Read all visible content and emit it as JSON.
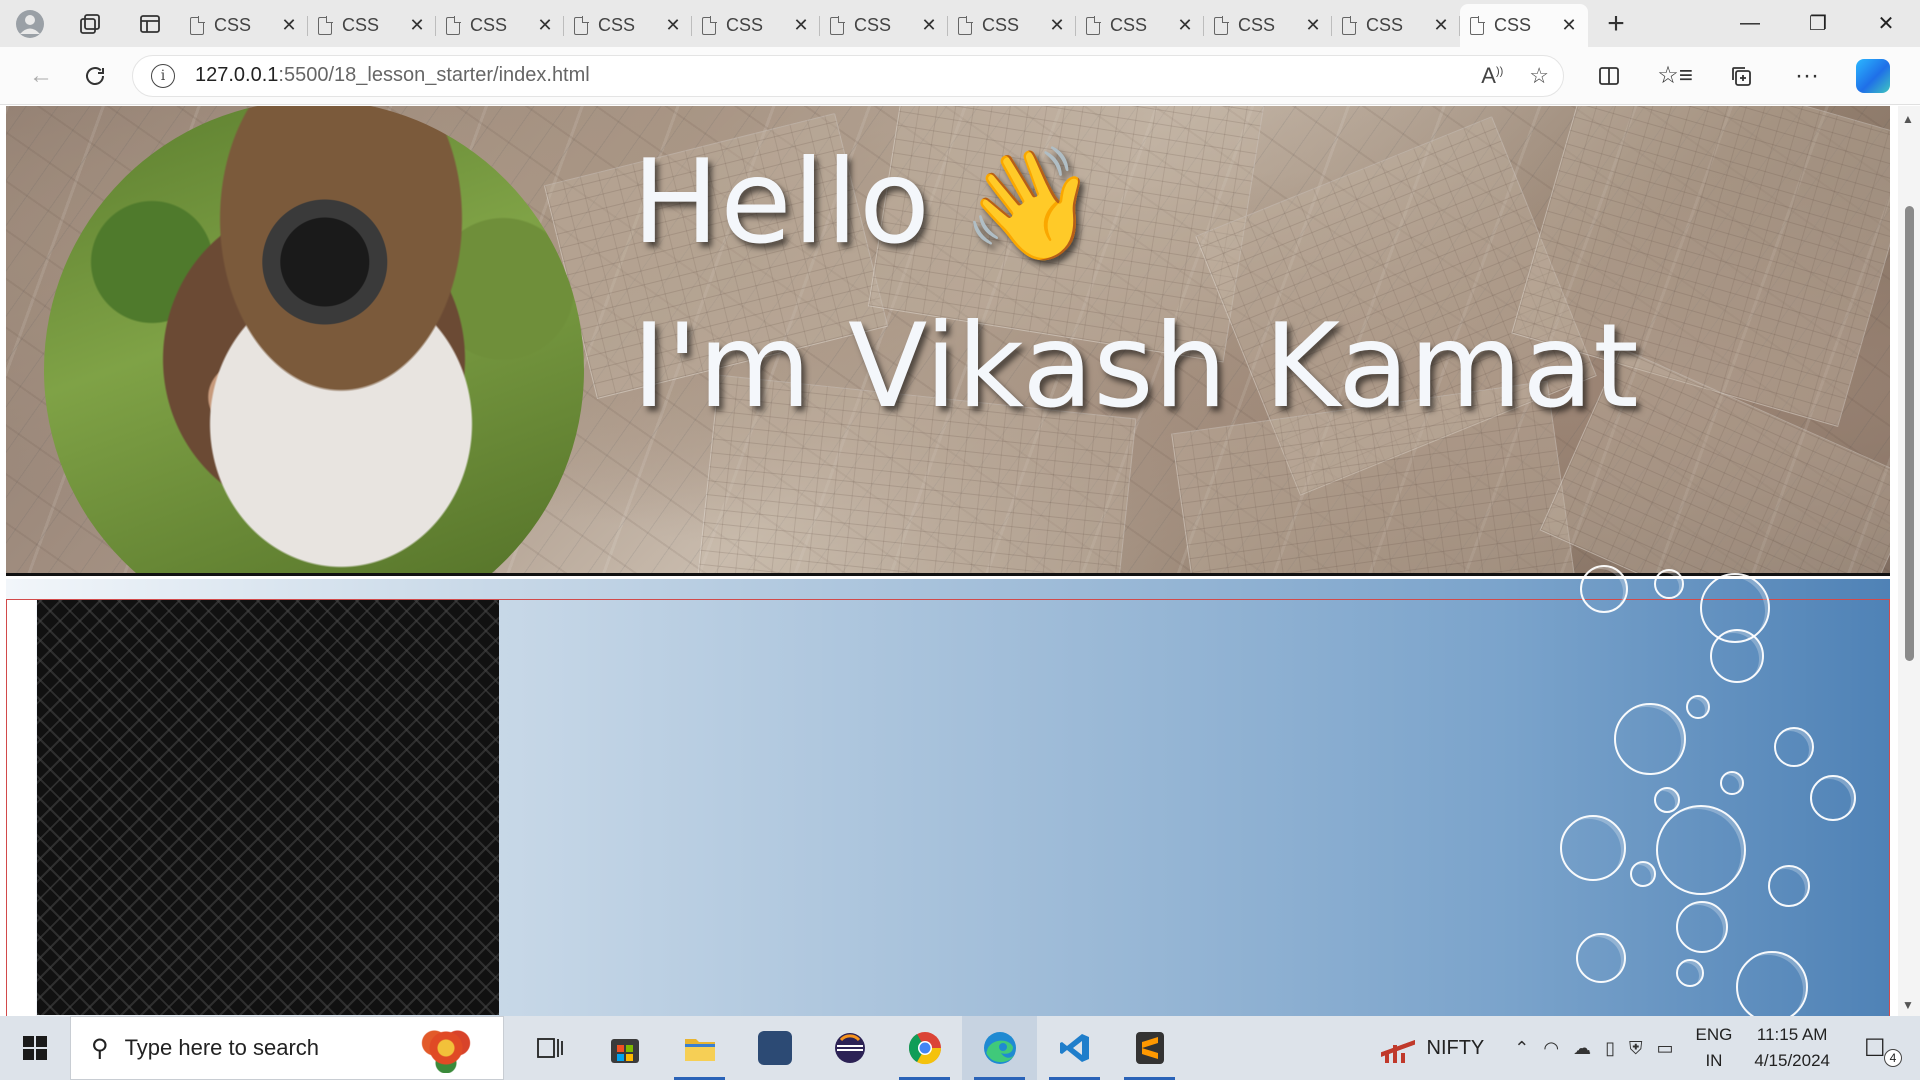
{
  "browser": {
    "tabs": [
      {
        "label": "CSS"
      },
      {
        "label": "CSS"
      },
      {
        "label": "CSS"
      },
      {
        "label": "CSS"
      },
      {
        "label": "CSS"
      },
      {
        "label": "CSS"
      },
      {
        "label": "CSS"
      },
      {
        "label": "CSS"
      },
      {
        "label": "CSS"
      },
      {
        "label": "CSS"
      },
      {
        "label": "CSS",
        "active": true
      }
    ],
    "close_glyph": "✕",
    "new_tab_glyph": "+",
    "url_host": "127.0.0.1",
    "url_rest": ":5500/18_lesson_starter/index.html",
    "info_glyph": "i"
  },
  "page": {
    "hello": "Hello",
    "wave_emoji": "👋",
    "name": "I'm Vikash Kamat"
  },
  "taskbar": {
    "search_placeholder": "Type here to search",
    "ticker_label": "NIFTY",
    "lang_line1": "ENG",
    "lang_line2": "IN",
    "time": "11:15 AM",
    "date": "4/15/2024",
    "notification_count": "4"
  },
  "icons": {
    "profile": "profile-icon",
    "workspaces": "workspaces-icon",
    "tab_actions": "vertical-tabs-icon",
    "back": "back-arrow-icon",
    "refresh": "refresh-icon",
    "read_aloud": "read-aloud-icon",
    "favorite": "star-icon",
    "split": "split-screen-icon",
    "favorites": "favorites-list-icon",
    "collections": "collections-icon",
    "more": "more-icon",
    "copilot": "copilot-icon"
  }
}
